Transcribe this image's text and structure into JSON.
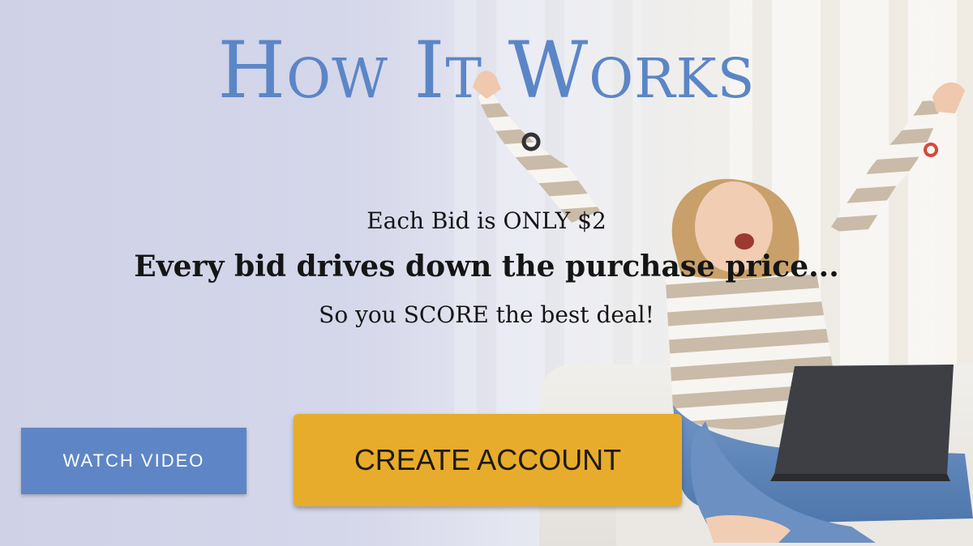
{
  "hero": {
    "title": "How It Works",
    "line1": "Each Bid is ONLY $2",
    "line2": "Every bid drives down the purchase price...",
    "line3": "So you SCORE the best deal!"
  },
  "buttons": {
    "watch_video": "WATCH VIDEO",
    "create_account": "CREATE ACCOUNT"
  },
  "colors": {
    "title": "#5b86c6",
    "watch_button": "#5e86c6",
    "create_button": "#e8ac2c"
  }
}
